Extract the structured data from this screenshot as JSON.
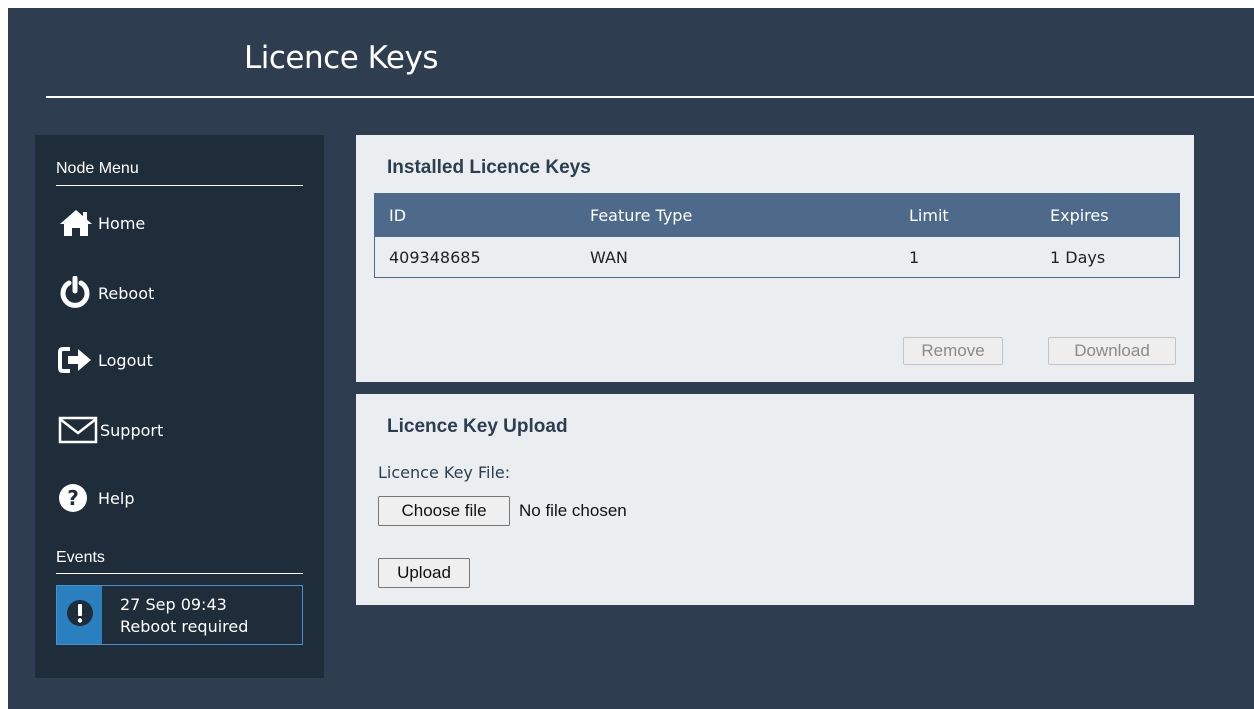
{
  "header": {
    "title": "Licence Keys"
  },
  "sidebar": {
    "menu_heading": "Node Menu",
    "items": [
      {
        "label": "Home",
        "icon": "home-icon"
      },
      {
        "label": "Reboot",
        "icon": "power-icon"
      },
      {
        "label": "Logout",
        "icon": "logout-icon"
      },
      {
        "label": "Support",
        "icon": "envelope-icon"
      },
      {
        "label": "Help",
        "icon": "question-circle-icon"
      }
    ],
    "events_heading": "Events",
    "event": {
      "time": "27 Sep 09:43",
      "message": "Reboot required",
      "icon": "exclamation-icon"
    }
  },
  "installed": {
    "title": "Installed Licence Keys",
    "columns": [
      "ID",
      "Feature Type",
      "Limit",
      "Expires"
    ],
    "rows": [
      [
        "409348685",
        "WAN",
        "1",
        "1 Days"
      ]
    ],
    "remove_label": "Remove",
    "download_label": "Download"
  },
  "upload": {
    "title": "Licence Key Upload",
    "field_label": "Licence Key File:",
    "choose_label": "Choose file",
    "file_status": "No file chosen",
    "upload_label": "Upload"
  },
  "colors": {
    "background": "#2e3e50",
    "sidebar": "#1f2c3a",
    "panel": "#ebeef0",
    "table_header": "#4d6a8a",
    "event_accent": "#2a7fbf"
  }
}
